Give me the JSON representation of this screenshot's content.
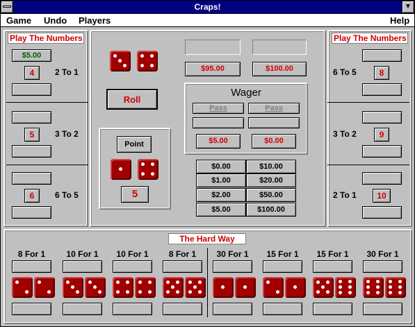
{
  "window": {
    "title": "Craps!"
  },
  "menu": {
    "game": "Game",
    "undo": "Undo",
    "players": "Players",
    "help": "Help"
  },
  "left": {
    "header": "Play The Numbers",
    "rows": [
      {
        "bet": "$5.00",
        "number": "4",
        "odds": "2 To 1"
      },
      {
        "bet": "",
        "number": "5",
        "odds": "3 To 2"
      },
      {
        "bet": "",
        "number": "6",
        "odds": "6 To 5"
      }
    ]
  },
  "right": {
    "header": "Play The Numbers",
    "rows": [
      {
        "bet": "",
        "number": "8",
        "odds": "6 To 5"
      },
      {
        "bet": "",
        "number": "9",
        "odds": "3 To 2"
      },
      {
        "bet": "",
        "number": "10",
        "odds": "2 To 1"
      }
    ]
  },
  "center": {
    "roll_label": "Roll",
    "point_label": "Point",
    "point_value": "5",
    "bankroll": [
      "$95.00",
      "$100.00"
    ],
    "wager_title": "Wager",
    "pass_labels": [
      "Pass",
      "Pass"
    ],
    "wager_values": [
      "$5.00",
      "$0.00"
    ],
    "chips": [
      "$0.00",
      "$10.00",
      "$1.00",
      "$20.00",
      "$2.00",
      "$50.00",
      "$5.00",
      "$100.00"
    ],
    "dice": [
      3,
      4
    ],
    "point_dice": [
      1,
      4
    ]
  },
  "hardway": {
    "header": "The Hard Way",
    "items": [
      {
        "odds": "8 For 1",
        "dice": [
          2,
          2
        ]
      },
      {
        "odds": "10 For 1",
        "dice": [
          3,
          3
        ]
      },
      {
        "odds": "10 For 1",
        "dice": [
          4,
          4
        ]
      },
      {
        "odds": "8 For 1",
        "dice": [
          5,
          5
        ]
      },
      {
        "odds": "30 For 1",
        "dice": [
          1,
          1
        ]
      },
      {
        "odds": "15 For 1",
        "dice": [
          2,
          1
        ]
      },
      {
        "odds": "15 For 1",
        "dice": [
          5,
          6
        ]
      },
      {
        "odds": "30 For 1",
        "dice": [
          6,
          6
        ]
      }
    ]
  }
}
